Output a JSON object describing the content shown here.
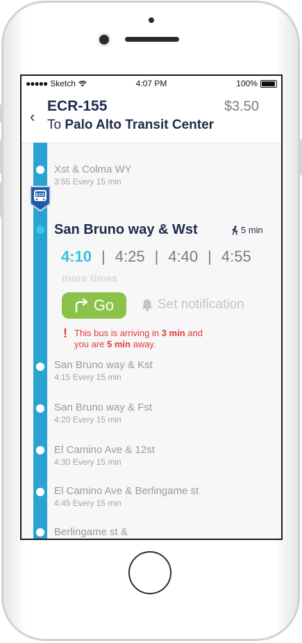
{
  "status_bar": {
    "carrier": "Sketch",
    "time": "4:07 PM",
    "battery": "100%"
  },
  "header": {
    "route": "ECR-155",
    "price": "$3.50",
    "to_prefix": "To",
    "destination": "Palo Alto Transit Center"
  },
  "bus_badge": "ECR",
  "current_stop": {
    "name": "San Bruno way & Wst",
    "walk": "5 min",
    "times": [
      "4:10",
      "4:25",
      "4:40",
      "4:55"
    ],
    "separator": "|",
    "more_times": "more times",
    "go_label": "Go",
    "notify_label": "Set notification",
    "alert": {
      "line1_a": "This bus is arriving in ",
      "line1_b": "3 min",
      "line1_c": " and",
      "line2_a": "you are ",
      "line2_b": "5 min",
      "line2_c": " away."
    }
  },
  "stops_before": [
    {
      "name": "Xst & Colma WY",
      "time": "3:55",
      "freq": "Every 15 min"
    }
  ],
  "stops_after": [
    {
      "name": "San Bruno way & Kst",
      "time": "4:15",
      "freq": "Every 15 min"
    },
    {
      "name": "San Bruno way & Fst",
      "time": "4:20",
      "freq": "Every 15 min"
    },
    {
      "name": "El Camino Ave & 12st",
      "time": "4:30",
      "freq": "Every 15 min"
    },
    {
      "name": "El Camino Ave & Berlingame st",
      "time": "4:45",
      "freq": "Every 15 min"
    },
    {
      "name": "Berlingame st &",
      "time": "",
      "freq": ""
    }
  ],
  "colors": {
    "line": "#2aa3d2",
    "accent": "#32c3dc",
    "go": "#8bc34a",
    "alert": "#e53935",
    "navy": "#1e2a4a"
  }
}
